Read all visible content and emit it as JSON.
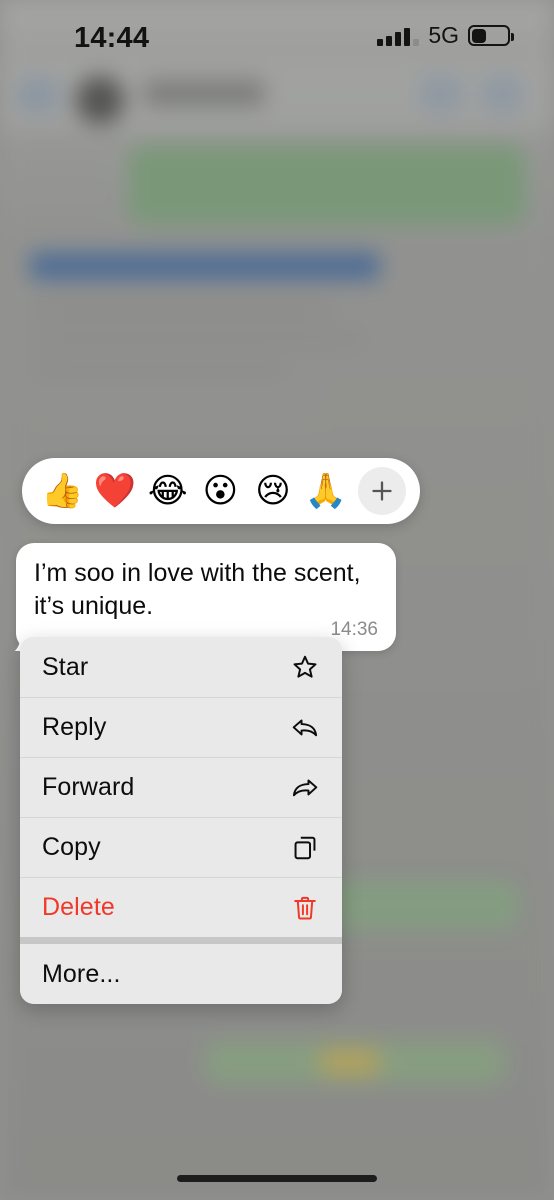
{
  "status_bar": {
    "time": "14:44",
    "network_label": "5G",
    "signal_icon": "cellular-signal-icon",
    "battery_icon": "battery-low-icon",
    "battery_level_percent": 25
  },
  "background_chat": {
    "description": "blurred messaging conversation behind modal",
    "header": {
      "back_icon": "back-arrow-icon",
      "avatar_icon": "contact-avatar",
      "video_call_icon": "video-call-icon",
      "voice_call_icon": "voice-call-icon"
    },
    "colors": {
      "outgoing_bubble": "#79a878",
      "link_highlight": "#3f6ead",
      "backdrop": "#9a9a98"
    }
  },
  "reaction_bar": {
    "emojis": [
      {
        "glyph": "👍",
        "name": "thumbs-up-emoji"
      },
      {
        "glyph": "❤️",
        "name": "red-heart-emoji"
      },
      {
        "glyph": "😂",
        "name": "tears-of-joy-emoji"
      },
      {
        "glyph": "😮",
        "name": "open-mouth-emoji"
      },
      {
        "glyph": "😢",
        "name": "crying-face-emoji"
      },
      {
        "glyph": "🙏",
        "name": "folded-hands-emoji"
      }
    ],
    "add_button_icon": "plus-icon",
    "background_color": "#ffffff"
  },
  "message": {
    "text": "I’m soo in love with the scent, it’s unique.",
    "time": "14:36",
    "bubble_color": "#ffffff",
    "time_color": "#8b8b8b"
  },
  "context_menu": {
    "background_color": "#e9e9e9",
    "danger_color": "#f0392b",
    "items": [
      {
        "label": "Star",
        "icon": "star-outline-icon",
        "danger": false
      },
      {
        "label": "Reply",
        "icon": "reply-arrow-icon",
        "danger": false
      },
      {
        "label": "Forward",
        "icon": "forward-arrow-icon",
        "danger": false
      },
      {
        "label": "Copy",
        "icon": "copy-icon",
        "danger": false
      },
      {
        "label": "Delete",
        "icon": "trash-icon",
        "danger": true
      },
      {
        "label": "More...",
        "icon": "none",
        "danger": false
      }
    ]
  },
  "home_indicator": {
    "name": "home-indicator-bar"
  }
}
